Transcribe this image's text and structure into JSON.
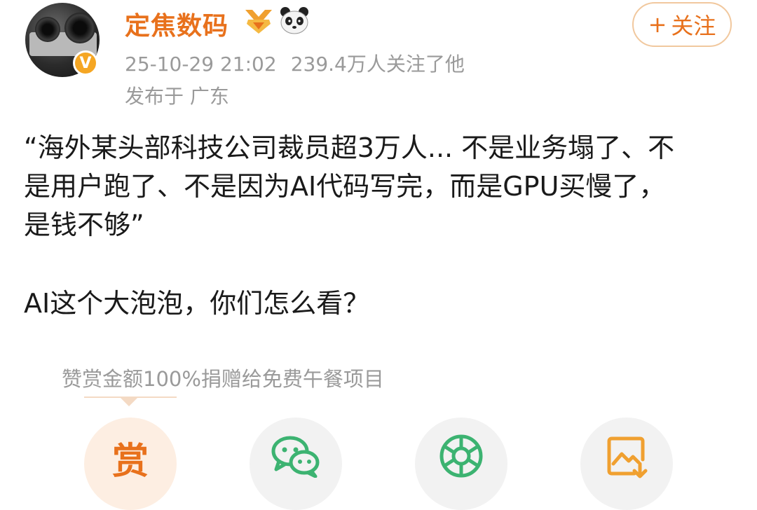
{
  "post": {
    "author": {
      "name": "定焦数码",
      "verified": true
    },
    "timestamp": "25-10-29 21:02",
    "followers": "239.4万人关注了他",
    "location": "发布于 广东",
    "follow_button": {
      "plus": "+",
      "label": "关注"
    },
    "lines": [
      "“海外某头部科技公司裁员超3万人... 不是业务塌了、不",
      "是用户跑了、不是因为AI代码写完，而是GPU买慢了，",
      "是钱不够”"
    ],
    "question": "AI这个大泡泡，你们怎么看？"
  },
  "reward": {
    "note": "赞赏金额100%捐赠给免费午餐项目",
    "button_label": "赏"
  },
  "share_actions": [
    {
      "icon": "wechat-icon"
    },
    {
      "icon": "moments-icon"
    },
    {
      "icon": "save-image-icon"
    }
  ],
  "colors": {
    "accent": "#e8711c",
    "muted": "#9a9a9a",
    "follow_border": "#f1c89e",
    "wechat_green": "#3cb371"
  }
}
